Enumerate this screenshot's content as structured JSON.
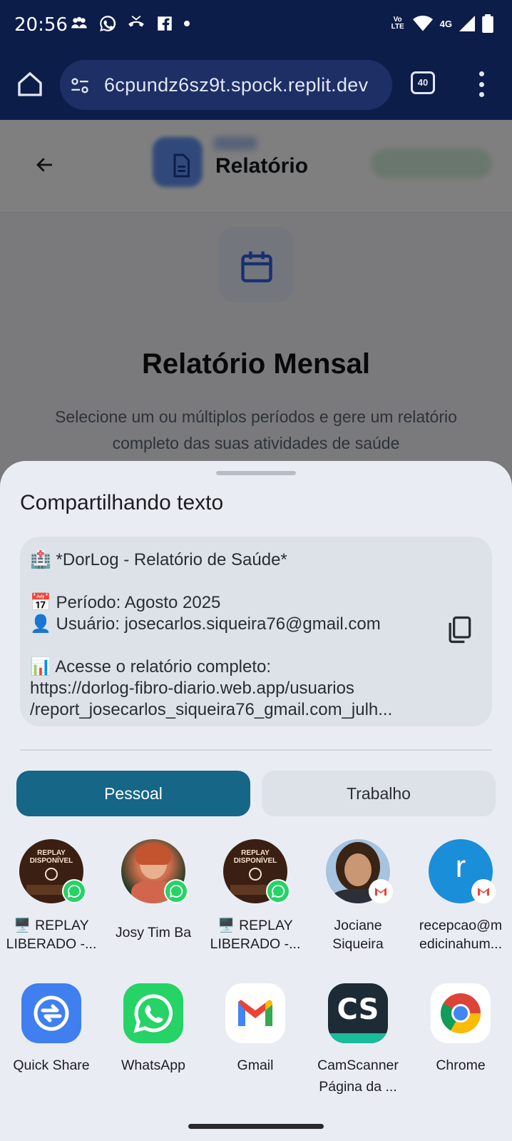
{
  "status_bar": {
    "time": "20:56",
    "network": "4G",
    "volte": "Vo LTE"
  },
  "browser": {
    "url": "6cpundz6sz9t.spock.replit.dev",
    "tab_count": "40"
  },
  "page": {
    "header_title": "Relatório",
    "heading": "Relatório Mensal",
    "subtitle": "Selecione um ou múltiplos períodos e gere um relatório completo das suas atividades de saúde"
  },
  "share_sheet": {
    "title": "Compartilhando texto",
    "preview": {
      "line1": "🏥 *DorLog - Relatório de Saúde*",
      "line2": "📅 Período: Agosto 2025",
      "line3": "👤 Usuário: josecarlos.siqueira76@gmail.com",
      "line4": "📊 Acesse o relatório completo:",
      "line5": "https://dorlog-fibro-diario.web.app/usuarios",
      "line6": "/report_josecarlos_siqueira76_gmail.com_julh..."
    },
    "tabs": [
      "Pessoal",
      "Trabalho"
    ],
    "direct_shares": [
      {
        "line1": "🖥️ REPLAY",
        "line2": "LIBERADO -...",
        "avatar_text": "REPLAY DISPONÍVEL",
        "badge": "whatsapp-icon"
      },
      {
        "line1": "Josy Tim Ba",
        "line2": "",
        "badge": "whatsapp-icon"
      },
      {
        "line1": "🖥️ REPLAY",
        "line2": "LIBERADO -...",
        "avatar_text": "REPLAY DISPONÍVEL",
        "badge": "whatsapp-icon"
      },
      {
        "line1": "Jociane",
        "line2": "Siqueira",
        "badge": "gmail-icon"
      },
      {
        "line1": "recepcao@m",
        "line2": "edicinahum...",
        "avatar_letter": "r",
        "badge": "gmail-icon"
      }
    ],
    "apps": [
      {
        "line1": "Quick Share",
        "line2": ""
      },
      {
        "line1": "WhatsApp",
        "line2": ""
      },
      {
        "line1": "Gmail",
        "line2": ""
      },
      {
        "line1": "CamScanner",
        "line2": "Página da ...",
        "logo_text": "CS"
      },
      {
        "line1": "Chrome",
        "line2": ""
      }
    ]
  },
  "colors": {
    "status_bar_bg": "#0d1d4a",
    "sheet_bg": "#e9edf3",
    "tab_active_bg": "#156687",
    "whatsapp_green": "#25d366",
    "quickshare_blue": "#3f7ff0"
  }
}
